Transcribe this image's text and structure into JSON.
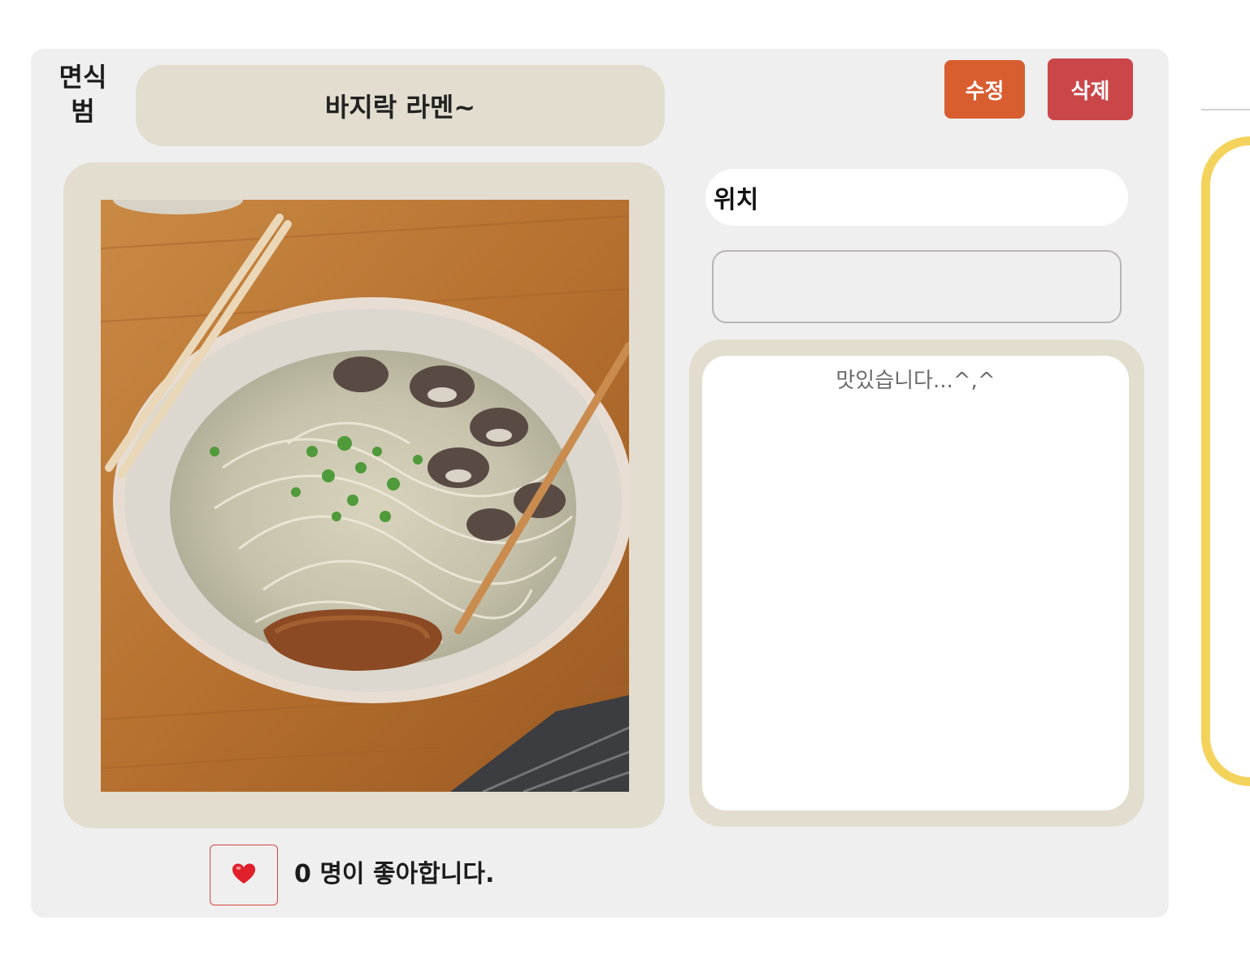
{
  "post": {
    "author": "면식범",
    "title": "바지락 라멘~",
    "edit_label": "수정",
    "delete_label": "삭제",
    "location_label": "위치",
    "location_value": "",
    "content": "맛있습니다...^,^",
    "like_icon": "heart-icon",
    "like_count": "0",
    "like_text": "0 명이 좋아합니다.",
    "photo_alt": "바지락 라멘"
  },
  "colors": {
    "card_bg": "#efefef",
    "frame_bg": "#e3ddcf",
    "edit_button": "#d85d2f",
    "delete_button": "#cb4649",
    "panel_border": "#f3d35b",
    "heart": "#e0202a"
  }
}
